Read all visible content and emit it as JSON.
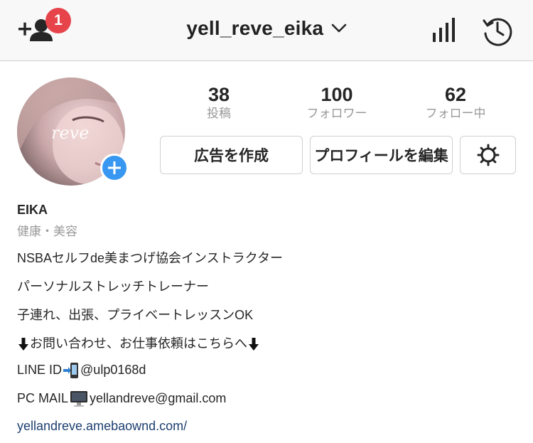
{
  "header": {
    "username": "yell_reve_eika",
    "notification_count": "1",
    "icons": {
      "add_user": "add-user-icon",
      "dropdown": "chevron-down-icon",
      "insights": "insights-icon",
      "archive": "history-icon"
    }
  },
  "profile": {
    "avatar_text": "reve",
    "stats": [
      {
        "count": "38",
        "label": "投稿"
      },
      {
        "count": "100",
        "label": "フォロワー"
      },
      {
        "count": "62",
        "label": "フォロー中"
      }
    ],
    "buttons": {
      "ad": "広告を作成",
      "edit": "プロフィールを編集",
      "settings_icon": "gear-icon"
    }
  },
  "bio": {
    "name": "EIKA",
    "category": "健康・美容",
    "lines": [
      "NSBAセルフde美まつげ協会インストラクター",
      "パーソナルストレッチトレーナー",
      "子連れ、出張、プライベートレッスンOK"
    ],
    "contact_line": "お問い合わせ、お仕事依頼はこちらへ",
    "line_id_label": "LINE ID",
    "line_id_value": "@ulp0168d",
    "pc_mail_label": "PC MAIL",
    "pc_mail_value": "yellandreve@gmail.com",
    "website": "yellandreve.amebaownd.com/"
  },
  "colors": {
    "accent_blue": "#3897f0",
    "badge_red": "#e6434b",
    "link": "#1d3f70",
    "muted": "#999999"
  }
}
